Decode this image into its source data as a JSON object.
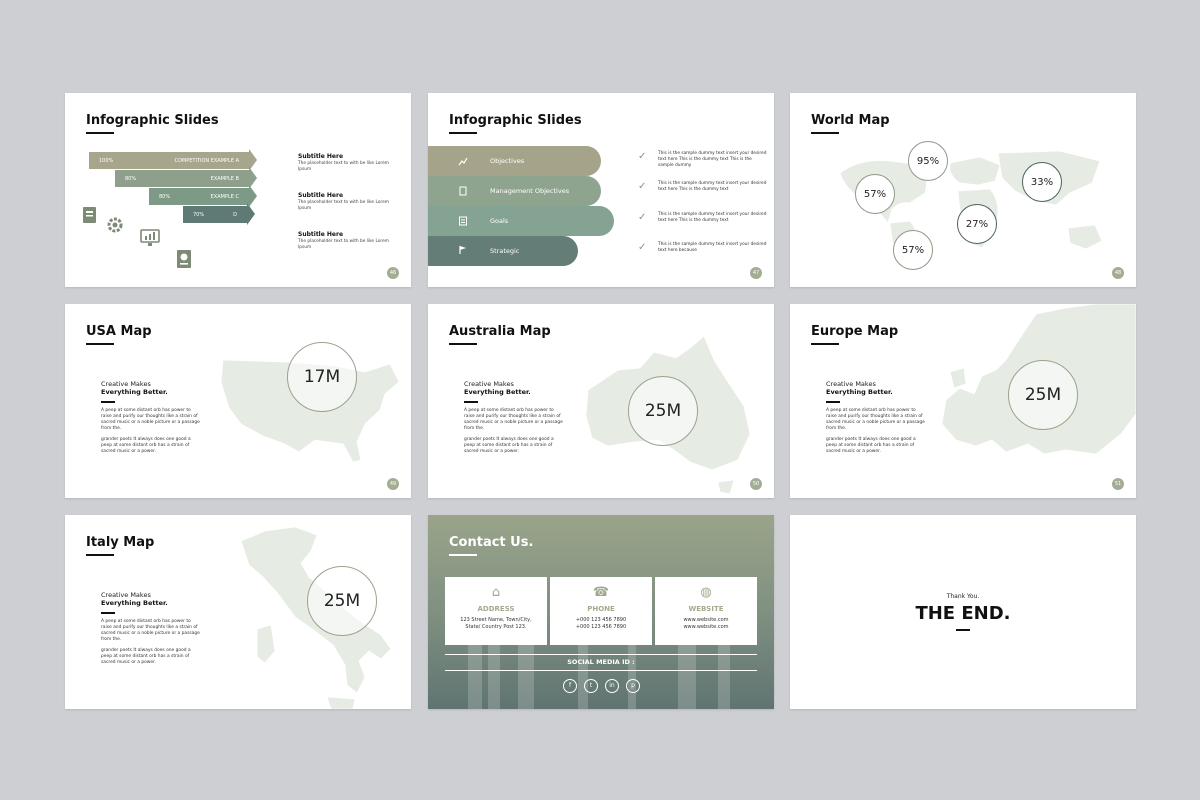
{
  "slides": {
    "infographic1": {
      "title": "Infographic Slides",
      "rows": [
        {
          "pct": "100%",
          "label": "COMPETITION EXAMPLE A",
          "color": "#a7a58b"
        },
        {
          "pct": "80%",
          "label": "EXAMPLE B",
          "color": "#8ea08b"
        },
        {
          "pct": "80%",
          "label": "EXAMPLE C",
          "color": "#7d9a86"
        },
        {
          "pct": "70%",
          "label": "D",
          "color": "#5f7a74"
        }
      ],
      "subtitles": [
        {
          "title": "Subtitle Here",
          "text": "The placeholder text to with be like Lorem Ipsum"
        },
        {
          "title": "Subtitle Here",
          "text": "The placeholder text to with be like Lorem Ipsum"
        },
        {
          "title": "Subtitle Here",
          "text": "The placeholder text to with be like Lorem Ipsum"
        }
      ],
      "page": "46"
    },
    "infographic2": {
      "title": "Infographic Slides",
      "items": [
        {
          "label": "Objectives",
          "color": "#a5a48a"
        },
        {
          "label": "Management Objectives",
          "color": "#8fa48e"
        },
        {
          "label": "Goals",
          "color": "#84a393"
        },
        {
          "label": "Strategic",
          "color": "#647d77"
        }
      ],
      "checks": [
        "This is the sample dummy text insert your desired text here This is the dummy text This is the sample dummy",
        "This is the sample dummy text insert your desired text here This is the dummy text",
        "This is the sample dummy text insert your desired text here This is the dummy text",
        "This is the sample dummy text insert your desired text here because"
      ],
      "page": "47"
    },
    "world": {
      "title": "World Map",
      "percents": [
        "95%",
        "57%",
        "33%",
        "27%",
        "57%"
      ],
      "page": "48"
    },
    "usa": {
      "title": "USA Map",
      "value": "17M",
      "h1": "Creative Makes",
      "h2": "Everything Better.",
      "p1": "A peep at some distant orb has power to raise and purify our thoughts like a strain of sacred music or a noble picture or a passage from the.",
      "p2": "grander poets It always does one good a peep at some distant orb has a strain of sacred music or a power.",
      "page": "49"
    },
    "australia": {
      "title": "Australia Map",
      "value": "25M",
      "h1": "Creative Makes",
      "h2": "Everything Better.",
      "p1": "A peep at some distant orb has power to raise and purify our thoughts like a strain of sacred music or a noble picture or a passage from the.",
      "p2": "grander poets It always does one good a peep at some distant orb has a strain of sacred music or a power.",
      "page": "50"
    },
    "europe": {
      "title": "Europe Map",
      "value": "25M",
      "h1": "Creative Makes",
      "h2": "Everything Better.",
      "p1": "A peep at some distant orb has power to raise and purify our thoughts like a strain of sacred music or a noble picture or a passage from the.",
      "p2": "grander poets It always does one good a peep at some distant orb has a strain of sacred music or a power.",
      "page": "51"
    },
    "italy": {
      "title": "Italy Map",
      "value": "25M",
      "h1": "Creative Makes",
      "h2": "Everything Better.",
      "p1": "A peep at some distant orb has power to raise and purify our thoughts like a strain of sacred music or a noble picture or a passage from the.",
      "p2": "grander poets It always does one good a peep at some distant orb has a strain of sacred music or a power."
    },
    "contact": {
      "title": "Contact Us.",
      "address": {
        "label": "ADDRESS",
        "line1": "123 Street Name, Town/City,",
        "line2": "State/ Country Post 123."
      },
      "phone": {
        "label": "PHONE",
        "line1": "+000 123 456 7890",
        "line2": "+000 123 456 7890"
      },
      "website": {
        "label": "WEBSITE",
        "line1": "www.website.com",
        "line2": "www.website.com"
      },
      "social": "SOCIAL MEDIA ID :",
      "icons": [
        "facebook-icon",
        "twitter-icon",
        "linkedin-icon",
        "pinterest-icon"
      ]
    },
    "end": {
      "thanks": "Thank You.",
      "title": "THE END."
    }
  },
  "colors": {
    "background": "#cdcfd2",
    "accent": "#a3ad94",
    "dark_teal": "#4c6260",
    "map_fill": "#e6ebe4"
  }
}
